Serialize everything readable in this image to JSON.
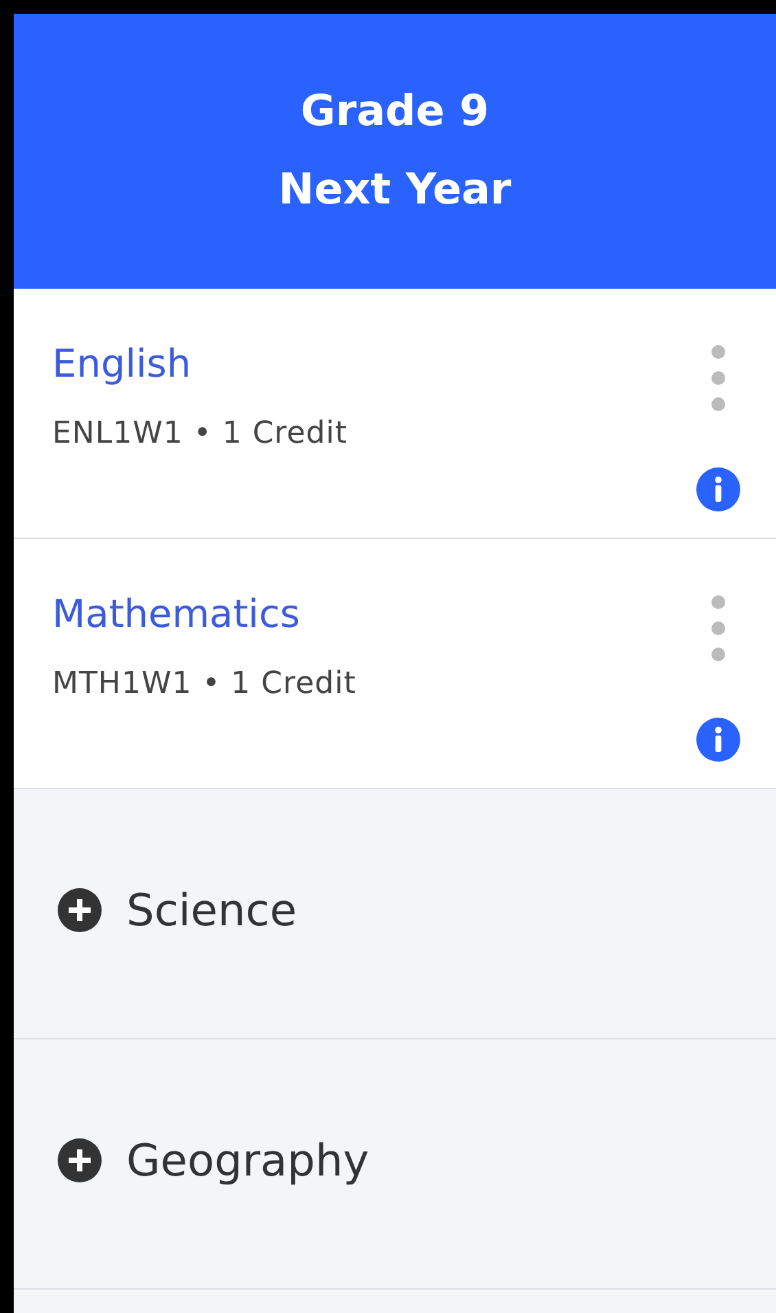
{
  "header": {
    "title": "Grade 9",
    "subtitle": "Next Year"
  },
  "slots": [
    {
      "kind": "course",
      "name": "English",
      "details": "ENL1W1 • 1 Credit"
    },
    {
      "kind": "course",
      "name": "Mathematics",
      "details": "MTH1W1 • 1 Credit"
    },
    {
      "kind": "empty",
      "label": "Science"
    },
    {
      "kind": "empty",
      "label": "Geography"
    }
  ]
}
